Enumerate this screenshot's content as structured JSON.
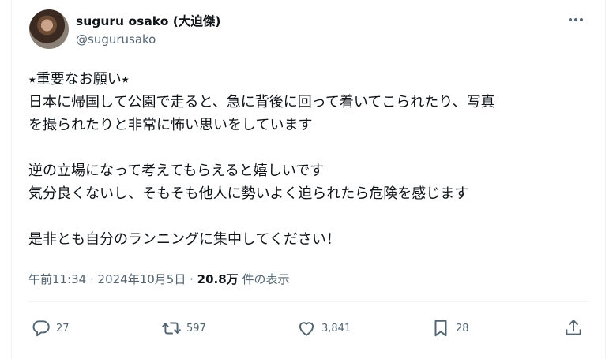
{
  "author": {
    "display_name": "suguru osako (大迫傑)",
    "handle": "@sugurusako"
  },
  "tweet": {
    "lines": [
      "⭑重要なお願い⭑",
      "日本に帰国して公園で走ると、急に背後に回って着いてこられたり、写真",
      "を撮られたりと非常に怖い思いをしています",
      "",
      "逆の立場になって考えてもらえると嬉しいです",
      "気分良くないし、そもそも他人に勢いよく迫られたら危険を感じます",
      "",
      "是非とも自分のランニングに集中してください！"
    ]
  },
  "meta": {
    "timestamp": "午前11:34 · 2024年10月5日 · ",
    "views": "20.8万",
    "views_label": " 件の表示"
  },
  "actions": {
    "reply": {
      "count": "27",
      "icon": "reply-icon"
    },
    "retweet": {
      "count": "597",
      "icon": "retweet-icon"
    },
    "like": {
      "count": "3,841",
      "icon": "heart-icon"
    },
    "bookmark": {
      "count": "28",
      "icon": "bookmark-icon"
    },
    "share": {
      "icon": "share-icon"
    }
  },
  "colors": {
    "text": "#0f1419",
    "secondary": "#536471",
    "border": "#eff3f4"
  }
}
